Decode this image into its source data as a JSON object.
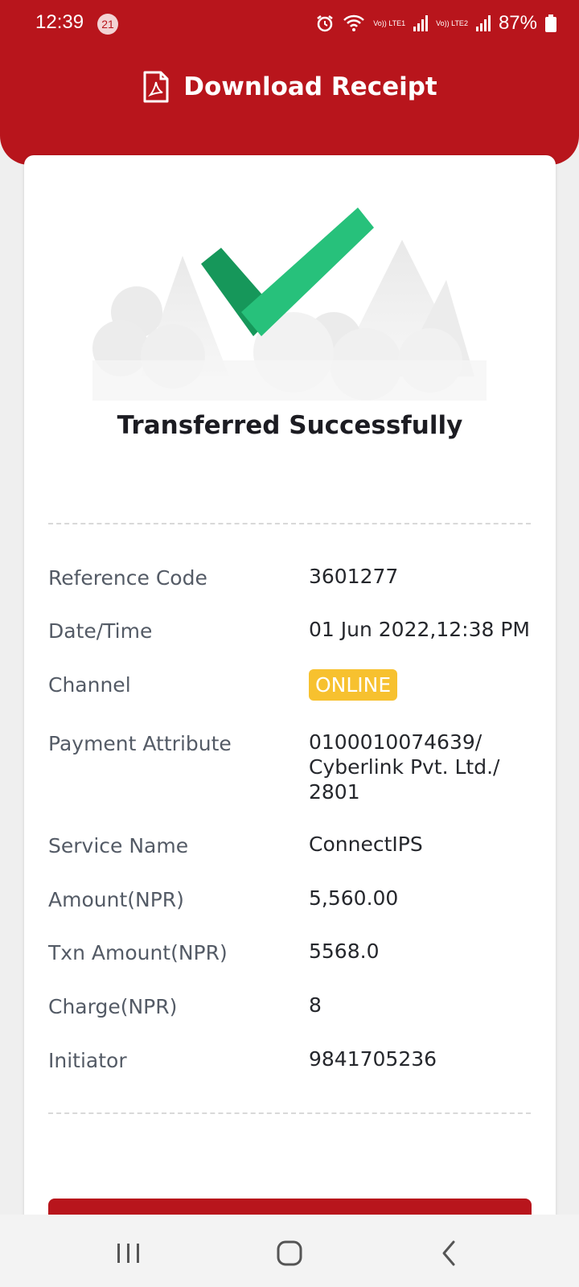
{
  "status_bar": {
    "time": "12:39",
    "notification_count": "21",
    "sim1_label": "Vo)) LTE1",
    "sim2_label": "Vo)) LTE2",
    "battery": "87%",
    "icons": [
      "alarm-icon",
      "wifi-icon",
      "signal-icon",
      "battery-icon"
    ]
  },
  "header": {
    "title": "Download Receipt",
    "icon": "pdf-document-icon",
    "color": "#b8151c"
  },
  "receipt": {
    "status_title": "Transferred Successfully",
    "rows": [
      {
        "label": "Reference Code",
        "value": "3601277"
      },
      {
        "label": "Date/Time",
        "value": "01 Jun 2022,12:38 PM"
      },
      {
        "label": "Channel",
        "value": "ONLINE"
      },
      {
        "label": "Payment Attribute",
        "value": "0100010074639/ Cyberlink Pvt. Ltd./ 2801"
      },
      {
        "label": "Service Name",
        "value": "ConnectIPS"
      },
      {
        "label": "Amount(NPR)",
        "value": "5,560.00"
      },
      {
        "label": "Txn Amount(NPR)",
        "value": "5568.0"
      },
      {
        "label": "Charge(NPR)",
        "value": "8"
      },
      {
        "label": "Initiator",
        "value": "9841705236"
      }
    ],
    "channel_badge_color": "#f7c12f"
  },
  "nav_bar": {
    "items": [
      "recent-apps-icon",
      "home-icon",
      "back-icon"
    ]
  }
}
